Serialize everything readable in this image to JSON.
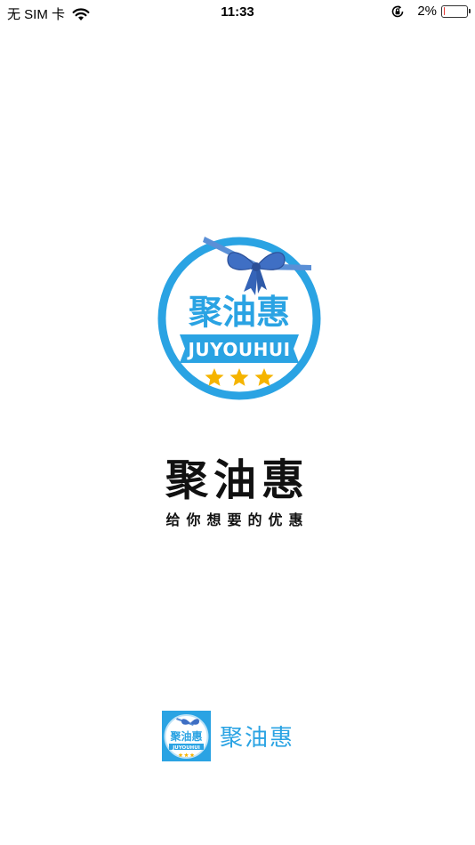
{
  "status_bar": {
    "carrier": "无 SIM 卡",
    "time": "11:33",
    "battery_percent": "2%",
    "battery_level": 0.02,
    "battery_fill_color": "#e53935"
  },
  "logo": {
    "name_cn": "聚油惠",
    "name_en": "JUYOUHUI",
    "stars": 3,
    "ring_color": "#2aa3e3",
    "star_color": "#f5b400"
  },
  "app": {
    "title": "聚油惠",
    "slogan": "给你想要的优惠"
  },
  "footer": {
    "name": "聚油惠"
  }
}
